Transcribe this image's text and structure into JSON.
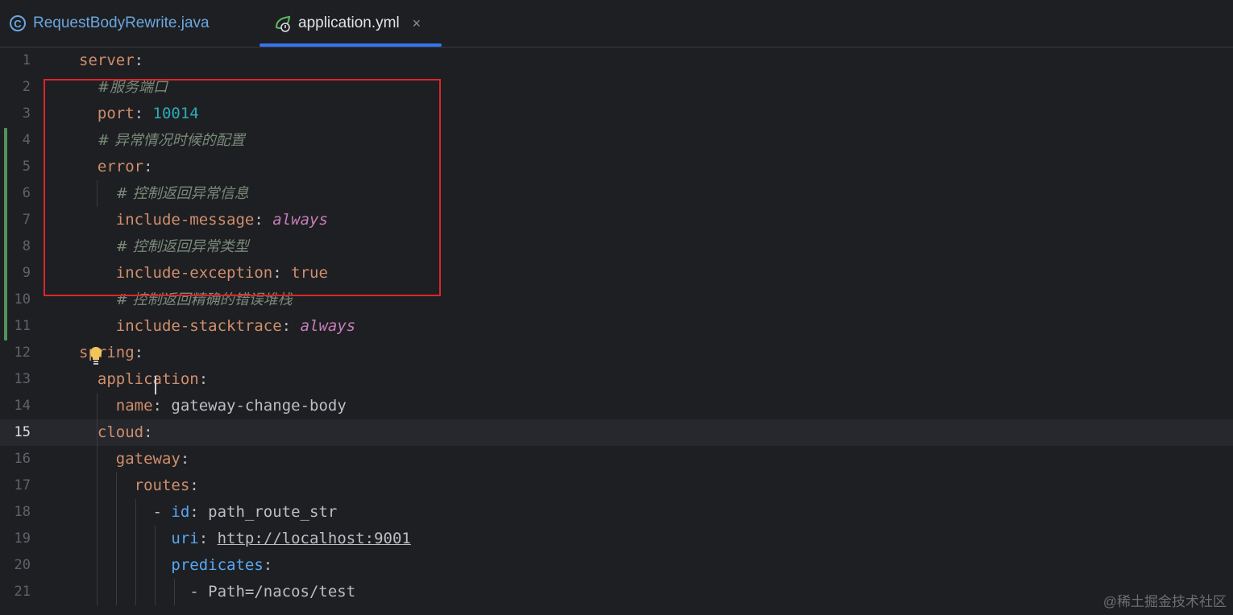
{
  "tabs": [
    {
      "label": "RequestBodyRewrite.java",
      "icon": "java-class-icon",
      "active": false
    },
    {
      "label": "application.yml",
      "icon": "spring-yaml-icon",
      "active": true,
      "close": "×"
    }
  ],
  "editor": {
    "current_line": 15,
    "lines": [
      {
        "n": "1",
        "parts": [
          [
            "k",
            "server"
          ],
          [
            "p",
            ":"
          ]
        ]
      },
      {
        "n": "2",
        "parts": [
          [
            "p",
            "  "
          ],
          [
            "c",
            "#服务端口"
          ]
        ]
      },
      {
        "n": "3",
        "parts": [
          [
            "p",
            "  "
          ],
          [
            "k",
            "port"
          ],
          [
            "p",
            ": "
          ],
          [
            "n",
            "10014"
          ]
        ]
      },
      {
        "n": "4",
        "parts": [
          [
            "p",
            "  "
          ],
          [
            "c",
            "# 异常情况时候的配置"
          ]
        ]
      },
      {
        "n": "5",
        "parts": [
          [
            "p",
            "  "
          ],
          [
            "k",
            "error"
          ],
          [
            "p",
            ":"
          ]
        ]
      },
      {
        "n": "6",
        "parts": [
          [
            "p",
            "    "
          ],
          [
            "c",
            "# 控制返回异常信息"
          ]
        ]
      },
      {
        "n": "7",
        "parts": [
          [
            "p",
            "    "
          ],
          [
            "k",
            "include-message"
          ],
          [
            "p",
            ": "
          ],
          [
            "a",
            "always"
          ]
        ]
      },
      {
        "n": "8",
        "parts": [
          [
            "p",
            "    "
          ],
          [
            "c",
            "# 控制返回异常类型"
          ]
        ]
      },
      {
        "n": "9",
        "parts": [
          [
            "p",
            "    "
          ],
          [
            "k",
            "include-exception"
          ],
          [
            "p",
            ": "
          ],
          [
            "t",
            "true"
          ]
        ]
      },
      {
        "n": "10",
        "parts": [
          [
            "p",
            "    "
          ],
          [
            "c",
            "# 控制返回精确的错误堆栈"
          ]
        ]
      },
      {
        "n": "11",
        "parts": [
          [
            "p",
            "    "
          ],
          [
            "k",
            "include-stacktrace"
          ],
          [
            "p",
            ": "
          ],
          [
            "a",
            "always"
          ]
        ]
      },
      {
        "n": "12",
        "parts": [
          [
            "k",
            "spring"
          ],
          [
            "p",
            ":"
          ]
        ]
      },
      {
        "n": "13",
        "parts": [
          [
            "p",
            "  "
          ],
          [
            "k",
            "application"
          ],
          [
            "p",
            ":"
          ]
        ]
      },
      {
        "n": "14",
        "parts": [
          [
            "p",
            "    "
          ],
          [
            "k",
            "name"
          ],
          [
            "p",
            ": "
          ],
          [
            "s",
            "gateway-change-body"
          ]
        ]
      },
      {
        "n": "15",
        "parts": [
          [
            "p",
            "  "
          ],
          [
            "k",
            "cloud"
          ],
          [
            "p",
            ":"
          ]
        ]
      },
      {
        "n": "16",
        "parts": [
          [
            "p",
            "    "
          ],
          [
            "k",
            "gateway"
          ],
          [
            "p",
            ":"
          ]
        ]
      },
      {
        "n": "17",
        "parts": [
          [
            "p",
            "      "
          ],
          [
            "k",
            "routes"
          ],
          [
            "p",
            ":"
          ]
        ]
      },
      {
        "n": "18",
        "parts": [
          [
            "p",
            "        - "
          ],
          [
            "b",
            "id"
          ],
          [
            "p",
            ": "
          ],
          [
            "s",
            "path_route_str"
          ]
        ]
      },
      {
        "n": "19",
        "parts": [
          [
            "p",
            "          "
          ],
          [
            "b",
            "uri"
          ],
          [
            "p",
            ": "
          ],
          [
            "u",
            "http://localhost:9001"
          ]
        ]
      },
      {
        "n": "20",
        "parts": [
          [
            "p",
            "          "
          ],
          [
            "b",
            "predicates"
          ],
          [
            "p",
            ":"
          ]
        ]
      },
      {
        "n": "21",
        "parts": [
          [
            "p",
            "            - "
          ],
          [
            "s",
            "Path=/nacos/test"
          ]
        ]
      }
    ]
  },
  "watermark": "@稀土掘金技术社区",
  "colors": {
    "accent": "#3574f0",
    "highlight_box": "#d9262b",
    "modified_gutter": "#549159"
  }
}
